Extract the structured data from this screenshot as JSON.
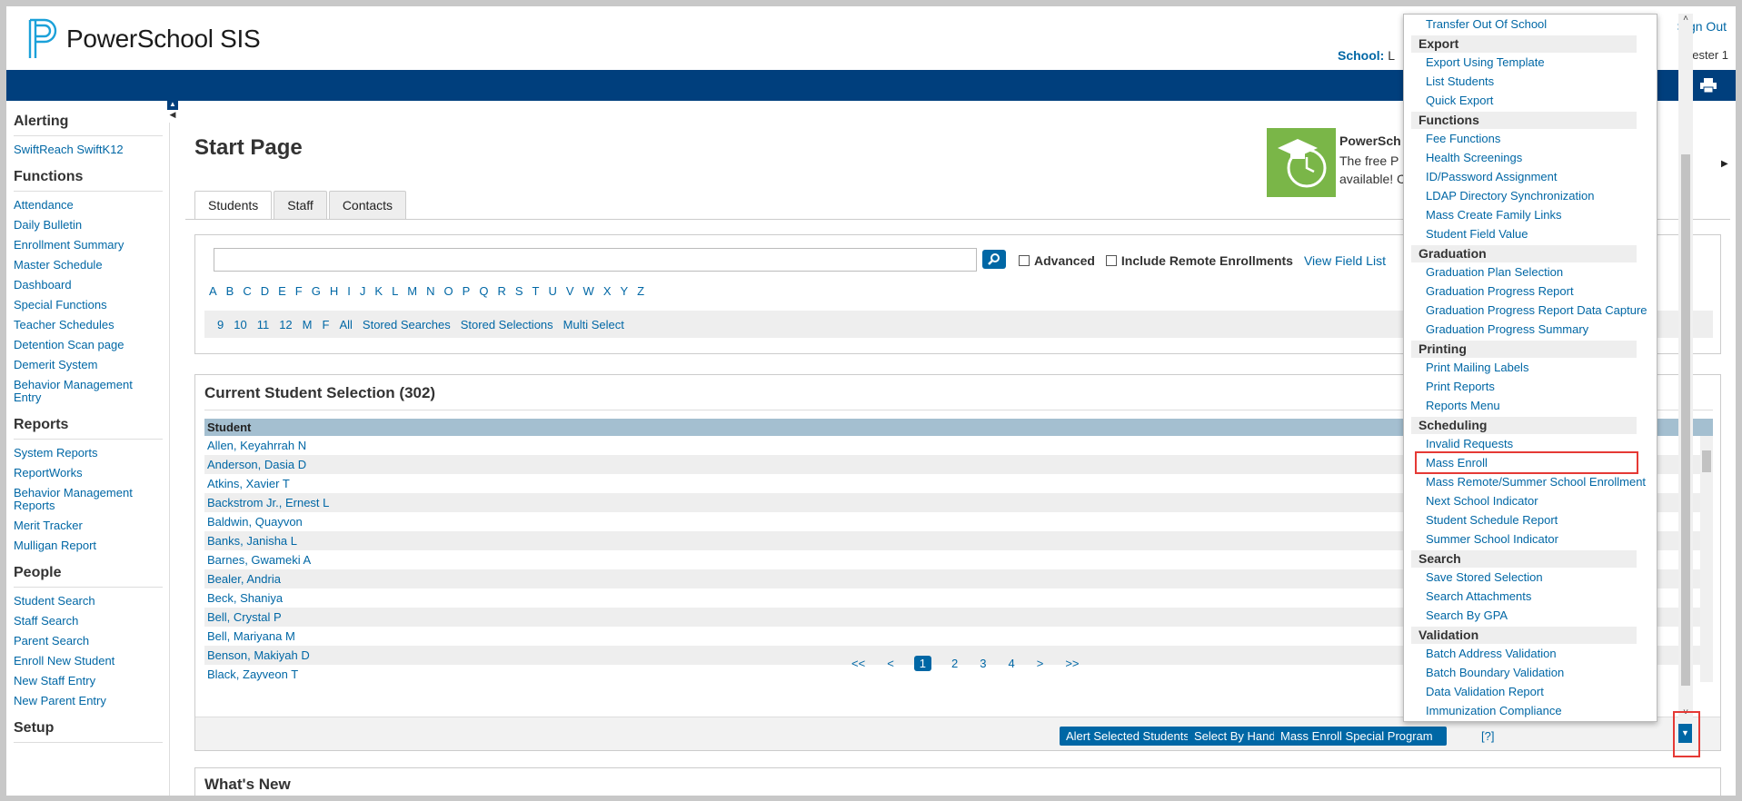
{
  "app": {
    "name": "PowerSchool SIS",
    "sign_out": "Sign Out",
    "school_label": "School:",
    "school_value": "L",
    "term_value": "ester 1"
  },
  "sidebar": {
    "sections": [
      {
        "title": "Alerting",
        "items": [
          "SwiftReach SwiftK12"
        ]
      },
      {
        "title": "Functions",
        "items": [
          "Attendance",
          "Daily Bulletin",
          "Enrollment Summary",
          "Master Schedule",
          "Dashboard",
          "Special Functions",
          "Teacher Schedules",
          "Detention Scan page",
          "Demerit System",
          "Behavior Management Entry"
        ]
      },
      {
        "title": "Reports",
        "items": [
          "System Reports",
          "ReportWorks",
          "Behavior Management Reports",
          "Merit Tracker",
          "Mulligan Report"
        ]
      },
      {
        "title": "People",
        "items": [
          "Student Search",
          "Staff Search",
          "Parent Search",
          "Enroll New Student",
          "New Staff Entry",
          "New Parent Entry"
        ]
      },
      {
        "title": "Setup",
        "items": []
      }
    ]
  },
  "main": {
    "title": "Start Page",
    "tabs": [
      "Students",
      "Staff",
      "Contacts"
    ],
    "promo": {
      "title": "PowerSch",
      "line1": "The free P",
      "line2": "available! C"
    },
    "search": {
      "advanced_label": "Advanced",
      "remote_label": "Include Remote Enrollments",
      "field_list": "View Field List",
      "letters": [
        "A",
        "B",
        "C",
        "D",
        "E",
        "F",
        "G",
        "H",
        "I",
        "J",
        "K",
        "L",
        "M",
        "N",
        "O",
        "P",
        "Q",
        "R",
        "S",
        "T",
        "U",
        "V",
        "W",
        "X",
        "Y",
        "Z"
      ],
      "grade_links": [
        "9",
        "10",
        "11",
        "12",
        "M",
        "F",
        "All",
        "Stored Searches",
        "Stored Selections",
        "Multi Select"
      ]
    },
    "selection": {
      "title": "Current Student Selection (302)",
      "column": "Student",
      "rows": [
        "Allen, Keyahrrah N",
        "Anderson, Dasia D",
        "Atkins, Xavier T",
        "Backstrom Jr., Ernest L",
        "Baldwin, Quayvon",
        "Banks, Janisha L",
        "Barnes, Gwameki A",
        "Bealer, Andria",
        "Beck, Shaniya",
        "Bell, Crystal P",
        "Bell, Mariyana M",
        "Benson, Makiyah D",
        "Black, Zayveon T"
      ],
      "pager": {
        "first": "<<",
        "prev": "<",
        "pages": [
          "1",
          "2",
          "3",
          "4"
        ],
        "next": ">",
        "last": ">>"
      },
      "buttons": {
        "alert": "Alert Selected Students",
        "by_hand": "Select By Hand",
        "mass_enroll": "Mass Enroll Special Program",
        "help": "[?]"
      }
    },
    "whats_new": "What's New"
  },
  "menu": {
    "top_item": "Transfer Out Of School",
    "groups": [
      {
        "title": "Export",
        "items": [
          "Export Using Template",
          "List Students",
          "Quick Export"
        ]
      },
      {
        "title": "Functions",
        "items": [
          "Fee Functions",
          "Health Screenings",
          "ID/Password Assignment",
          "LDAP Directory Synchronization",
          "Mass Create Family Links",
          "Student Field Value"
        ]
      },
      {
        "title": "Graduation",
        "items": [
          "Graduation Plan Selection",
          "Graduation Progress Report",
          "Graduation Progress Report Data Capture",
          "Graduation Progress Summary"
        ]
      },
      {
        "title": "Printing",
        "items": [
          "Print Mailing Labels",
          "Print Reports",
          "Reports Menu"
        ]
      },
      {
        "title": "Scheduling",
        "items": [
          "Invalid Requests",
          "Mass Enroll",
          "Mass Remote/Summer School Enrollment",
          "Next School Indicator",
          "Student Schedule Report",
          "Summer School Indicator"
        ]
      },
      {
        "title": "Search",
        "items": [
          "Save Stored Selection",
          "Search Attachments",
          "Search By GPA"
        ]
      },
      {
        "title": "Validation",
        "items": [
          "Batch Address Validation",
          "Batch Boundary Validation",
          "Data Validation Report",
          "Immunization Compliance"
        ]
      }
    ],
    "highlighted": "Mass Enroll"
  },
  "colors": {
    "brand_blue": "#003f7d",
    "link": "#0067a5",
    "highlight": "#e53935",
    "table_header": "#a4bfd0"
  }
}
